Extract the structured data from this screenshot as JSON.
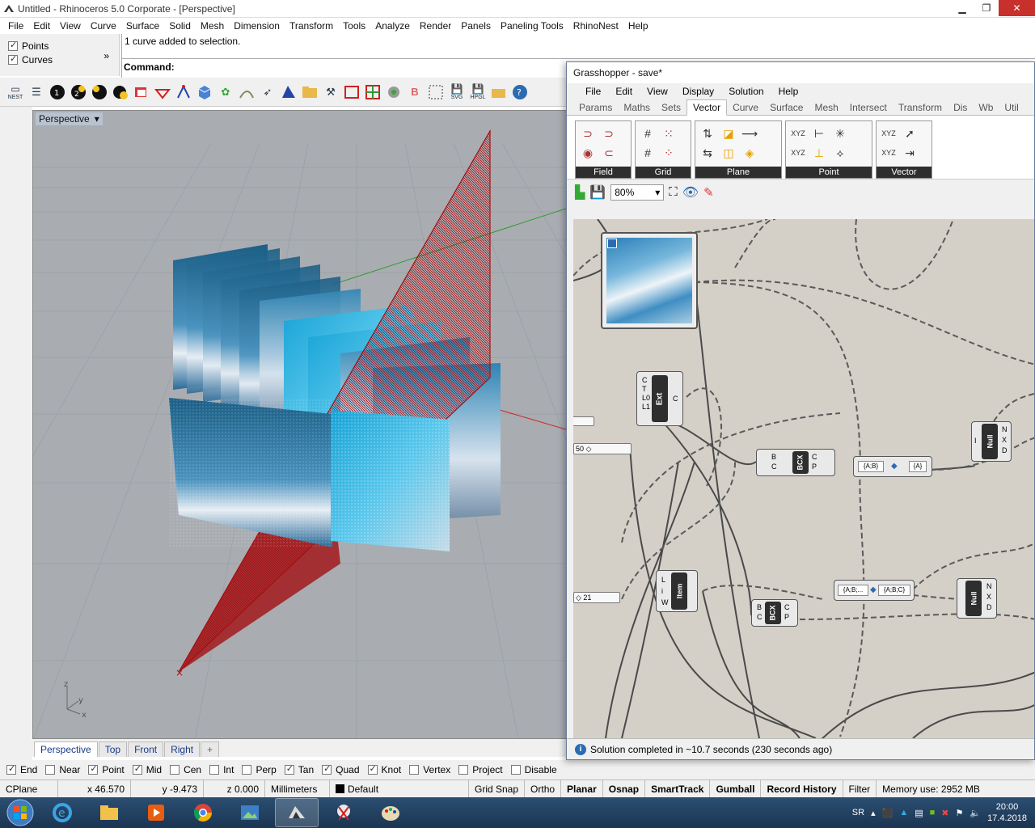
{
  "rhino": {
    "title": "Untitled - Rhinoceros  5.0 Corporate - [Perspective]",
    "menu": [
      "File",
      "Edit",
      "View",
      "Curve",
      "Surface",
      "Solid",
      "Mesh",
      "Dimension",
      "Transform",
      "Tools",
      "Analyze",
      "Render",
      "Panels",
      "Paneling Tools",
      "RhinoNest",
      "Help"
    ],
    "filters": [
      {
        "label": "Points",
        "checked": true
      },
      {
        "label": "Curves",
        "checked": true
      }
    ],
    "more_glyph": "»",
    "command_history": "1 curve added to selection.",
    "command_prompt": "Command:",
    "toolbar_icons": [
      "nest-icon",
      "list-icon",
      "layer-1-icon",
      "layer-2-icon",
      "layer-3-icon",
      "layer-4-icon",
      "render-icon",
      "arrow-icon",
      "point-icon",
      "box-icon",
      "star-icon",
      "curve-icon",
      "cursor-icon",
      "rhino-icon",
      "folder-icon",
      "tools-icon",
      "select-icon",
      "grid-icon",
      "sphere-icon",
      "bold-icon",
      "frame-icon",
      "save-svg-icon",
      "save-hpgl-icon",
      "open-icon",
      "help-icon"
    ],
    "toolbar_labels": {
      "nest": "NEST",
      "svg": "SVG",
      "hpgl": "HPGL"
    },
    "viewport_title": "Perspective",
    "viewport_tabs": [
      "Perspective",
      "Top",
      "Front",
      "Right"
    ],
    "viewport_add": "+",
    "axis_labels": {
      "z": "z",
      "y": "y",
      "x": "x"
    },
    "osnaps": [
      {
        "label": "End",
        "checked": true
      },
      {
        "label": "Near",
        "checked": false
      },
      {
        "label": "Point",
        "checked": true
      },
      {
        "label": "Mid",
        "checked": true
      },
      {
        "label": "Cen",
        "checked": false
      },
      {
        "label": "Int",
        "checked": false
      },
      {
        "label": "Perp",
        "checked": false
      },
      {
        "label": "Tan",
        "checked": true
      },
      {
        "label": "Quad",
        "checked": true
      },
      {
        "label": "Knot",
        "checked": true
      },
      {
        "label": "Vertex",
        "checked": false
      },
      {
        "label": "Project",
        "checked": false
      },
      {
        "label": "Disable",
        "checked": false
      }
    ],
    "status": {
      "cplane": "CPlane",
      "x": "x 46.570",
      "y": "y -9.473",
      "z": "z 0.000",
      "units": "Millimeters",
      "layer": "Default",
      "grid_snap": "Grid Snap",
      "ortho": "Ortho",
      "planar": "Planar",
      "osnap": "Osnap",
      "smarttrack": "SmartTrack",
      "gumball": "Gumball",
      "record_history": "Record History",
      "filter": "Filter",
      "memory": "Memory use: 2952 MB"
    }
  },
  "grasshopper": {
    "title": "Grasshopper - save*",
    "menu": [
      "File",
      "Edit",
      "View",
      "Display",
      "Solution",
      "Help"
    ],
    "tabs": [
      "Params",
      "Maths",
      "Sets",
      "Vector",
      "Curve",
      "Surface",
      "Mesh",
      "Intersect",
      "Transform",
      "Dis",
      "Wb",
      "Util"
    ],
    "active_tab": "Vector",
    "groups": [
      "Field",
      "Grid",
      "Plane",
      "Point",
      "Vector"
    ],
    "zoom": "80%",
    "nodes": {
      "ext": {
        "label": "Ext",
        "inputs": [
          "C",
          "T",
          "L0",
          "L1"
        ],
        "output": "C"
      },
      "bcx1": {
        "label": "BCX",
        "inputs": [
          "B",
          "C"
        ],
        "outputs": [
          "C",
          "P"
        ]
      },
      "bcx2": {
        "label": "BCX",
        "inputs": [
          "B",
          "C"
        ],
        "outputs": [
          "C",
          "P"
        ]
      },
      "item": {
        "label": "Item",
        "inputs": [
          "L",
          "i",
          "W"
        ]
      },
      "null1": {
        "label": "Null",
        "outputs": [
          "N",
          "X",
          "D"
        ],
        "input": "I"
      },
      "null2": {
        "label": "Null",
        "outputs": [
          "N",
          "X",
          "D"
        ]
      },
      "slider1": "50",
      "slider2": "21",
      "param1_in": "{A;B}",
      "param1_out": "{A}",
      "param2_in": "{A;B;...",
      "param2_out": "{A;B;C}"
    },
    "status": "Solution completed in ~10.7 seconds (230 seconds ago)"
  },
  "taskbar": {
    "lang": "SR",
    "time": "20:00",
    "date": "17.4.2018"
  },
  "colors": {
    "viewport_bg": "#a9adb2",
    "grid_line": "#9ca1a7",
    "red_curve": "#a30f12",
    "gh_canvas": "#d4d0c8",
    "taskbar": "#1f3b5b"
  }
}
